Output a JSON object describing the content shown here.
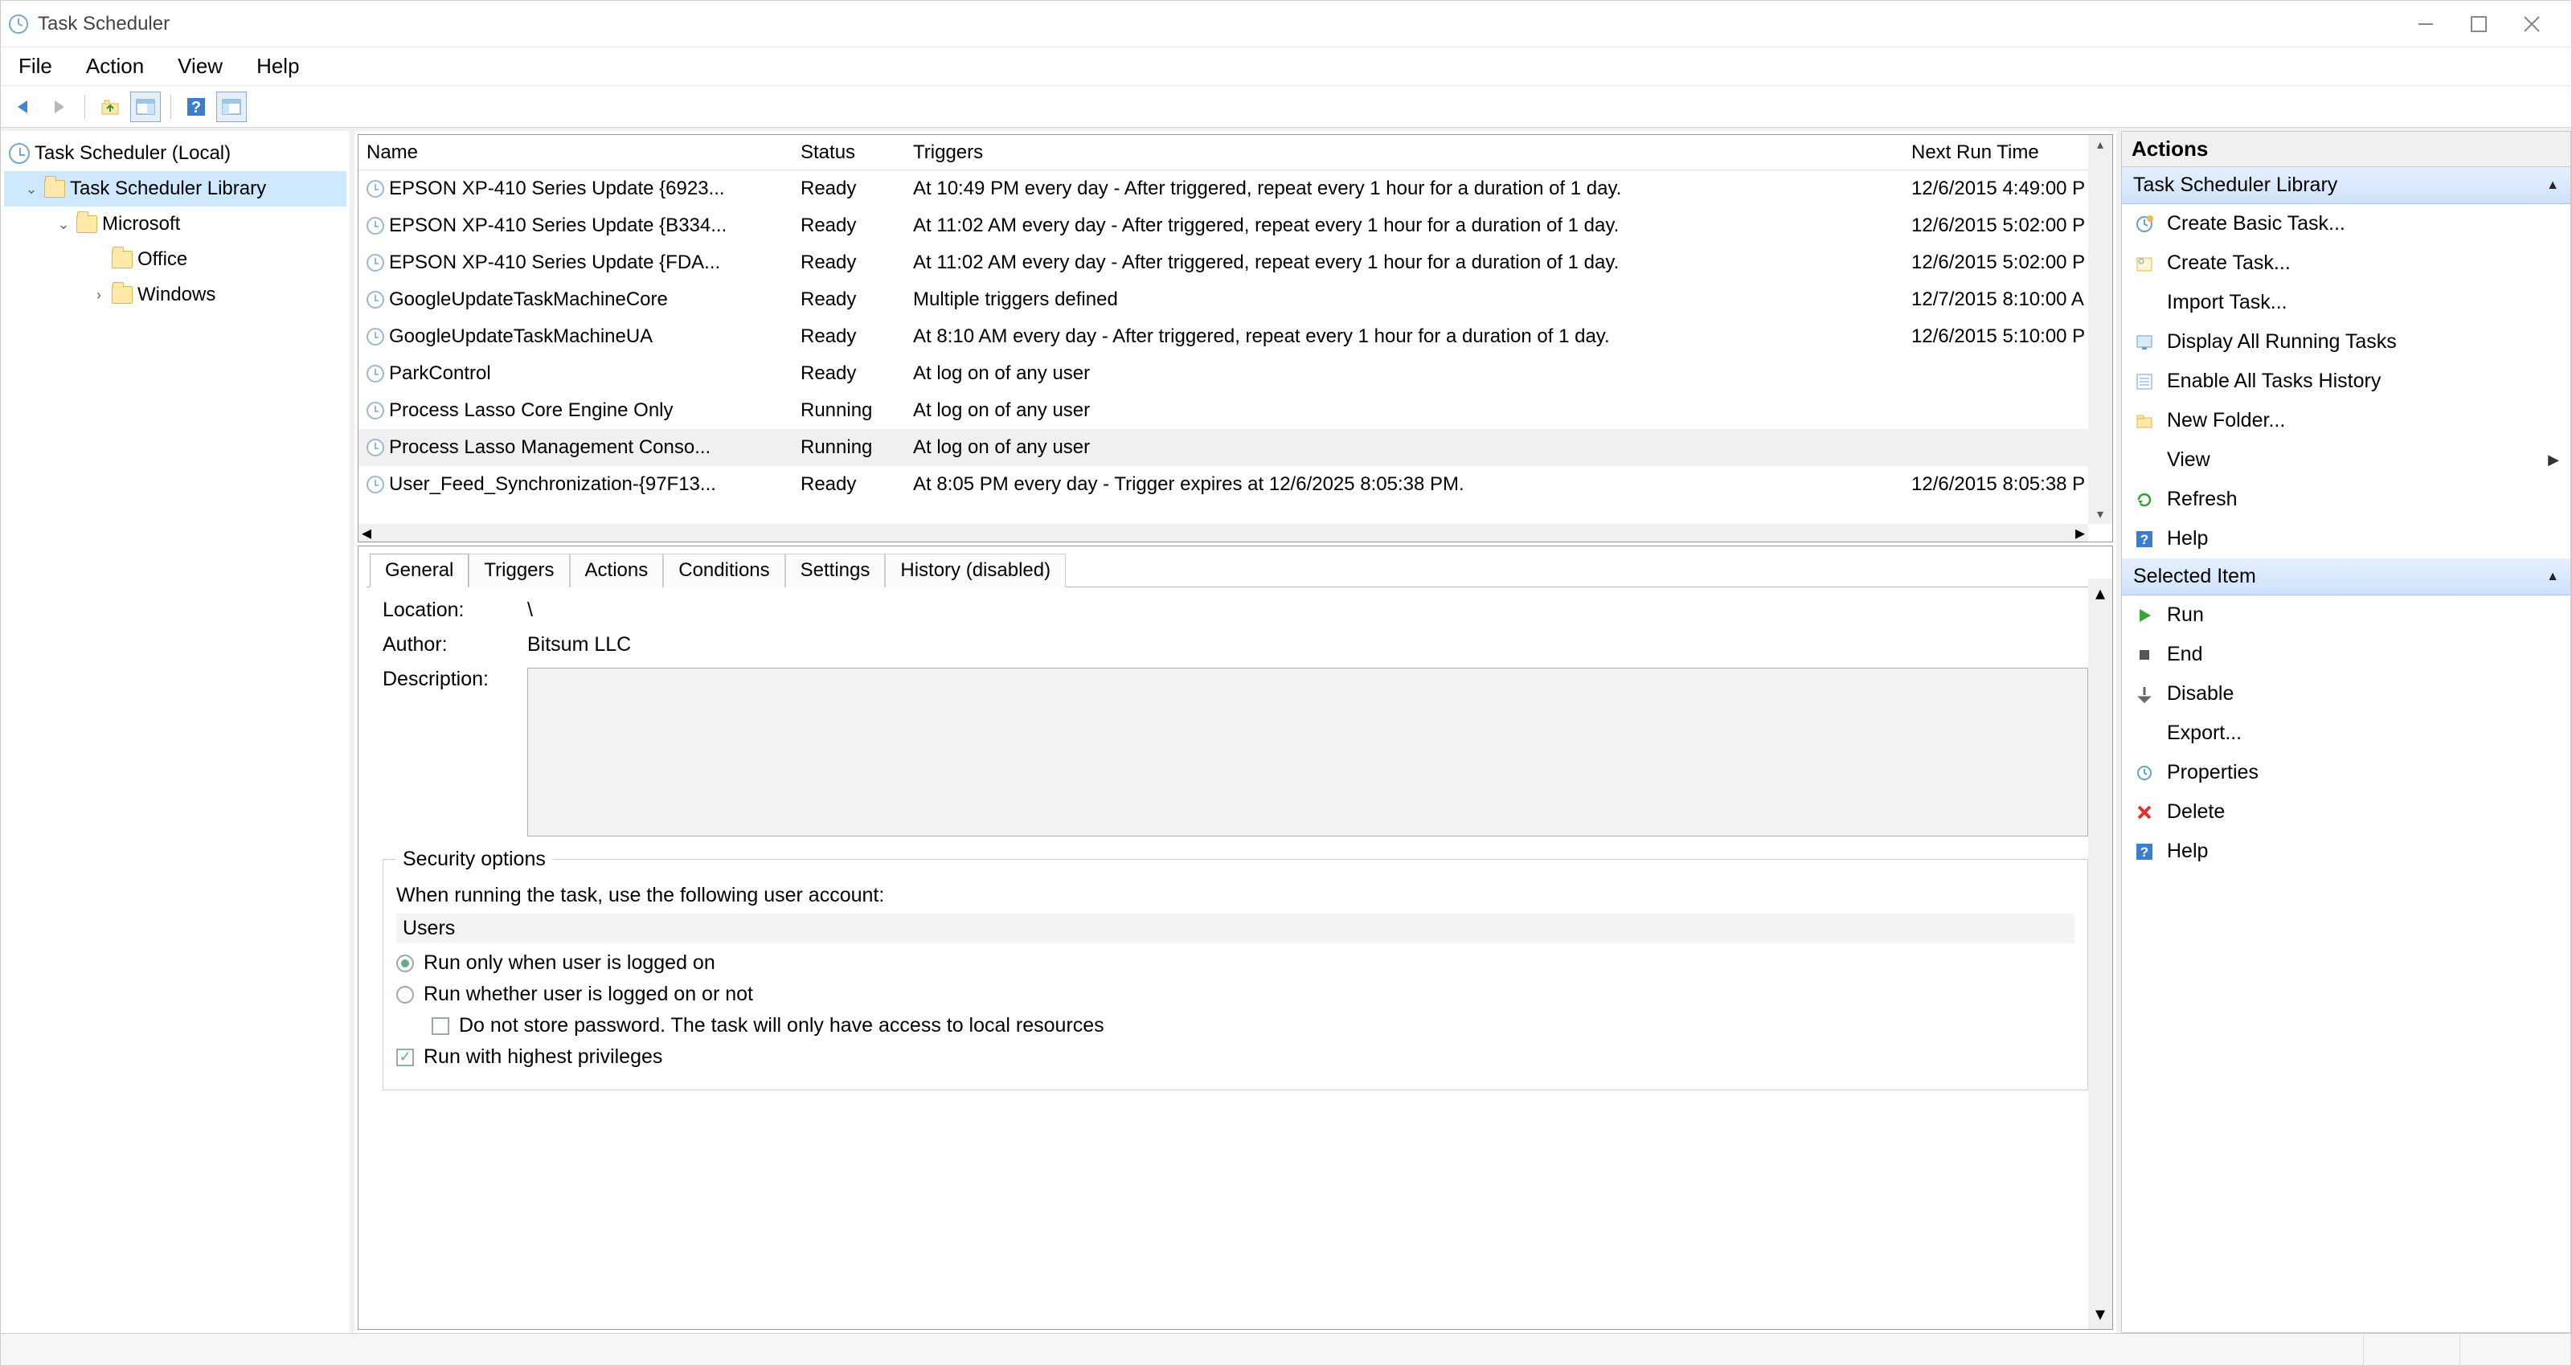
{
  "titlebar": {
    "title": "Task Scheduler"
  },
  "menubar": [
    "File",
    "Action",
    "View",
    "Help"
  ],
  "tree": {
    "root": "Task Scheduler (Local)",
    "library": "Task Scheduler Library",
    "microsoft": "Microsoft",
    "office": "Office",
    "windows": "Windows"
  },
  "taskcols": {
    "name": "Name",
    "status": "Status",
    "triggers": "Triggers",
    "next": "Next Run Time"
  },
  "tasks": [
    {
      "name": "EPSON XP-410 Series Update {6923...",
      "status": "Ready",
      "trigger": "At 10:49 PM every day - After triggered, repeat every 1 hour for a duration of 1 day.",
      "next": "12/6/2015 4:49:00 P"
    },
    {
      "name": "EPSON XP-410 Series Update {B334...",
      "status": "Ready",
      "trigger": "At 11:02 AM every day - After triggered, repeat every 1 hour for a duration of 1 day.",
      "next": "12/6/2015 5:02:00 P"
    },
    {
      "name": "EPSON XP-410 Series Update {FDA...",
      "status": "Ready",
      "trigger": "At 11:02 AM every day - After triggered, repeat every 1 hour for a duration of 1 day.",
      "next": "12/6/2015 5:02:00 P"
    },
    {
      "name": "GoogleUpdateTaskMachineCore",
      "status": "Ready",
      "trigger": "Multiple triggers defined",
      "next": "12/7/2015 8:10:00 A"
    },
    {
      "name": "GoogleUpdateTaskMachineUA",
      "status": "Ready",
      "trigger": "At 8:10 AM every day - After triggered, repeat every 1 hour for a duration of 1 day.",
      "next": "12/6/2015 5:10:00 P"
    },
    {
      "name": "ParkControl",
      "status": "Ready",
      "trigger": "At log on of any user",
      "next": ""
    },
    {
      "name": "Process Lasso Core Engine Only",
      "status": "Running",
      "trigger": "At log on of any user",
      "next": ""
    },
    {
      "name": "Process Lasso Management Conso...",
      "status": "Running",
      "trigger": "At log on of any user",
      "next": "",
      "selected": true
    },
    {
      "name": "User_Feed_Synchronization-{97F13...",
      "status": "Ready",
      "trigger": "At 8:05 PM every day - Trigger expires at 12/6/2025 8:05:38 PM.",
      "next": "12/6/2015 8:05:38 P"
    }
  ],
  "tabs": [
    "General",
    "Triggers",
    "Actions",
    "Conditions",
    "Settings",
    "History (disabled)"
  ],
  "general": {
    "location_label": "Location:",
    "location": "\\",
    "author_label": "Author:",
    "author": "Bitsum LLC",
    "description_label": "Description:",
    "security_legend": "Security options",
    "security_prompt": "When running the task, use the following user account:",
    "user": "Users",
    "opt_logged_on": "Run only when user is logged on",
    "opt_whether": "Run whether user is logged on or not",
    "opt_nopwd": "Do not store password.  The task will only have access to local resources",
    "opt_highest": "Run with highest privileges"
  },
  "actions_panel": {
    "header": "Actions",
    "section1": "Task Scheduler Library",
    "items1": [
      "Create Basic Task...",
      "Create Task...",
      "Import Task...",
      "Display All Running Tasks",
      "Enable All Tasks History",
      "New Folder...",
      "View",
      "Refresh",
      "Help"
    ],
    "section2": "Selected Item",
    "items2": [
      "Run",
      "End",
      "Disable",
      "Export...",
      "Properties",
      "Delete",
      "Help"
    ]
  }
}
